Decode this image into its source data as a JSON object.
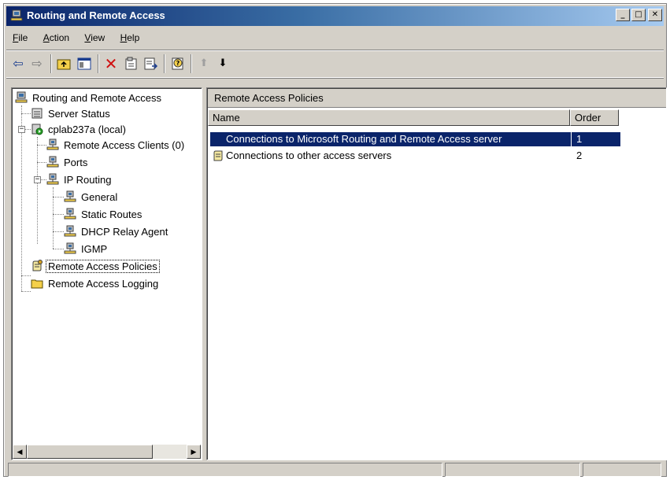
{
  "window": {
    "title": "Routing and Remote Access",
    "controls": {
      "minimize": "_",
      "maximize": "□",
      "close": "✕"
    }
  },
  "menu": {
    "items": [
      {
        "key": "F",
        "rest": "ile"
      },
      {
        "key": "A",
        "rest": "ction"
      },
      {
        "key": "V",
        "rest": "iew"
      },
      {
        "key": "H",
        "rest": "elp"
      }
    ]
  },
  "toolbar": {
    "icons": [
      "back-arrow-icon",
      "forward-arrow-icon",
      "up-folder-icon",
      "show-hide-tree-icon",
      "delete-icon",
      "properties-icon",
      "export-list-icon",
      "help-icon",
      "move-up-icon",
      "move-down-icon"
    ],
    "back": "⇦",
    "forward": "⇨",
    "delete": "✕",
    "move_up": "⬆",
    "move_down": "⬇"
  },
  "tree": {
    "root": "Routing and Remote Access",
    "items": {
      "server_status": "Server Status",
      "server": "cplab237a (local)",
      "remote_access_clients": "Remote Access Clients (0)",
      "ports": "Ports",
      "ip_routing": "IP Routing",
      "general": "General",
      "static_routes": "Static Routes",
      "dhcp_relay": "DHCP Relay Agent",
      "igmp": "IGMP",
      "remote_access_policies": "Remote Access Policies",
      "remote_access_logging": "Remote Access Logging"
    },
    "expander_minus": "−"
  },
  "right_pane": {
    "title": "Remote Access Policies",
    "columns": {
      "name": "Name",
      "order": "Order"
    },
    "rows": [
      {
        "name": "Connections to Microsoft Routing and Remote Access server",
        "order": "1",
        "selected": true
      },
      {
        "name": "Connections to other access servers",
        "order": "2",
        "selected": false
      }
    ]
  },
  "scrollbar": {
    "left": "◀",
    "right": "▶"
  },
  "colors": {
    "title_start": "#0a246a",
    "title_end": "#a6caf0",
    "face": "#d4d0c8",
    "selection": "#0a246a"
  }
}
